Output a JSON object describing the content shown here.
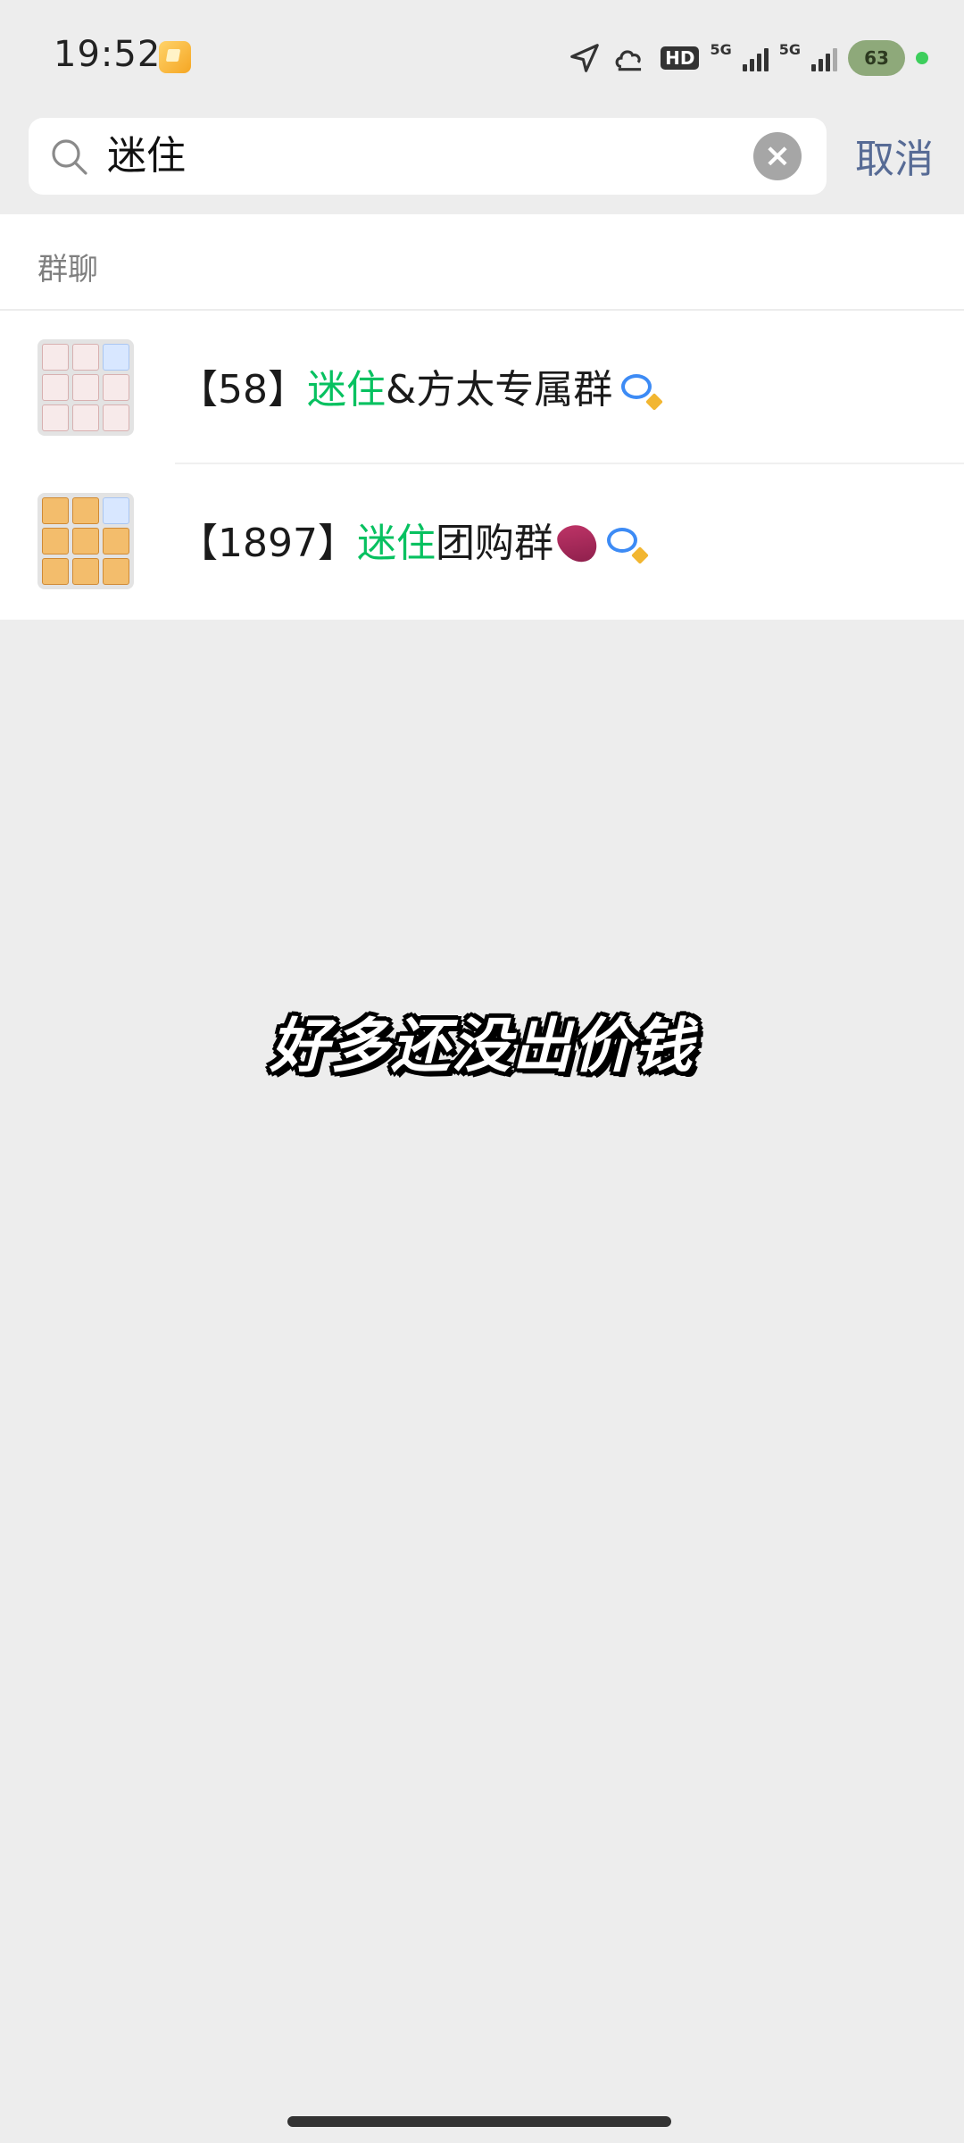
{
  "status_bar": {
    "time": "19:52",
    "hd_label": "HD",
    "network_1": "5G",
    "network_2": "5G",
    "battery": "63",
    "icons": [
      "location-arrow-icon",
      "cloud-sync-icon",
      "hd-icon",
      "signal-icon",
      "signal-icon",
      "battery-icon"
    ]
  },
  "search": {
    "query": "迷住",
    "cancel_label": "取消"
  },
  "results": {
    "section_title": "群聊",
    "items": [
      {
        "prefix": "【58】",
        "highlight": "迷住",
        "suffix": "&方太专属群",
        "avatar_style": "red"
      },
      {
        "prefix": "【1897】",
        "highlight": "迷住",
        "suffix": "团购群",
        "avatar_style": "orange"
      }
    ]
  },
  "caption": "好多还没出价钱",
  "colors": {
    "highlight": "#07c160",
    "cancel": "#576b95",
    "background": "#ededed"
  }
}
